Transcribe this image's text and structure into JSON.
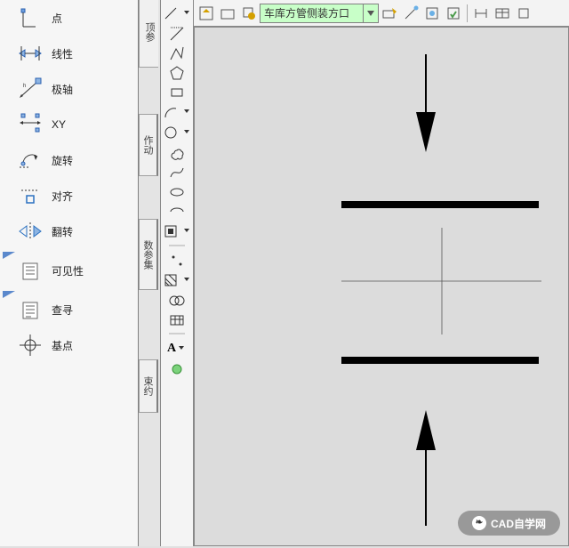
{
  "sidebar": {
    "items": [
      {
        "label": "点"
      },
      {
        "label": "线性"
      },
      {
        "label": "极轴"
      },
      {
        "label": "XY"
      },
      {
        "label": "旋转"
      },
      {
        "label": "对齐"
      },
      {
        "label": "翻转"
      },
      {
        "label": "可见性"
      },
      {
        "label": "查寻"
      },
      {
        "label": "基点"
      }
    ]
  },
  "vert_tabs": {
    "tab1": "顶参",
    "tab2": "作动",
    "tab3": "数参集",
    "tab4": "束约"
  },
  "toolbar": {
    "combo_value": "车库方管侧装方口"
  },
  "text_tool": {
    "a": "A"
  },
  "watermark": {
    "text": "CAD自学网",
    "icon": "❧"
  }
}
